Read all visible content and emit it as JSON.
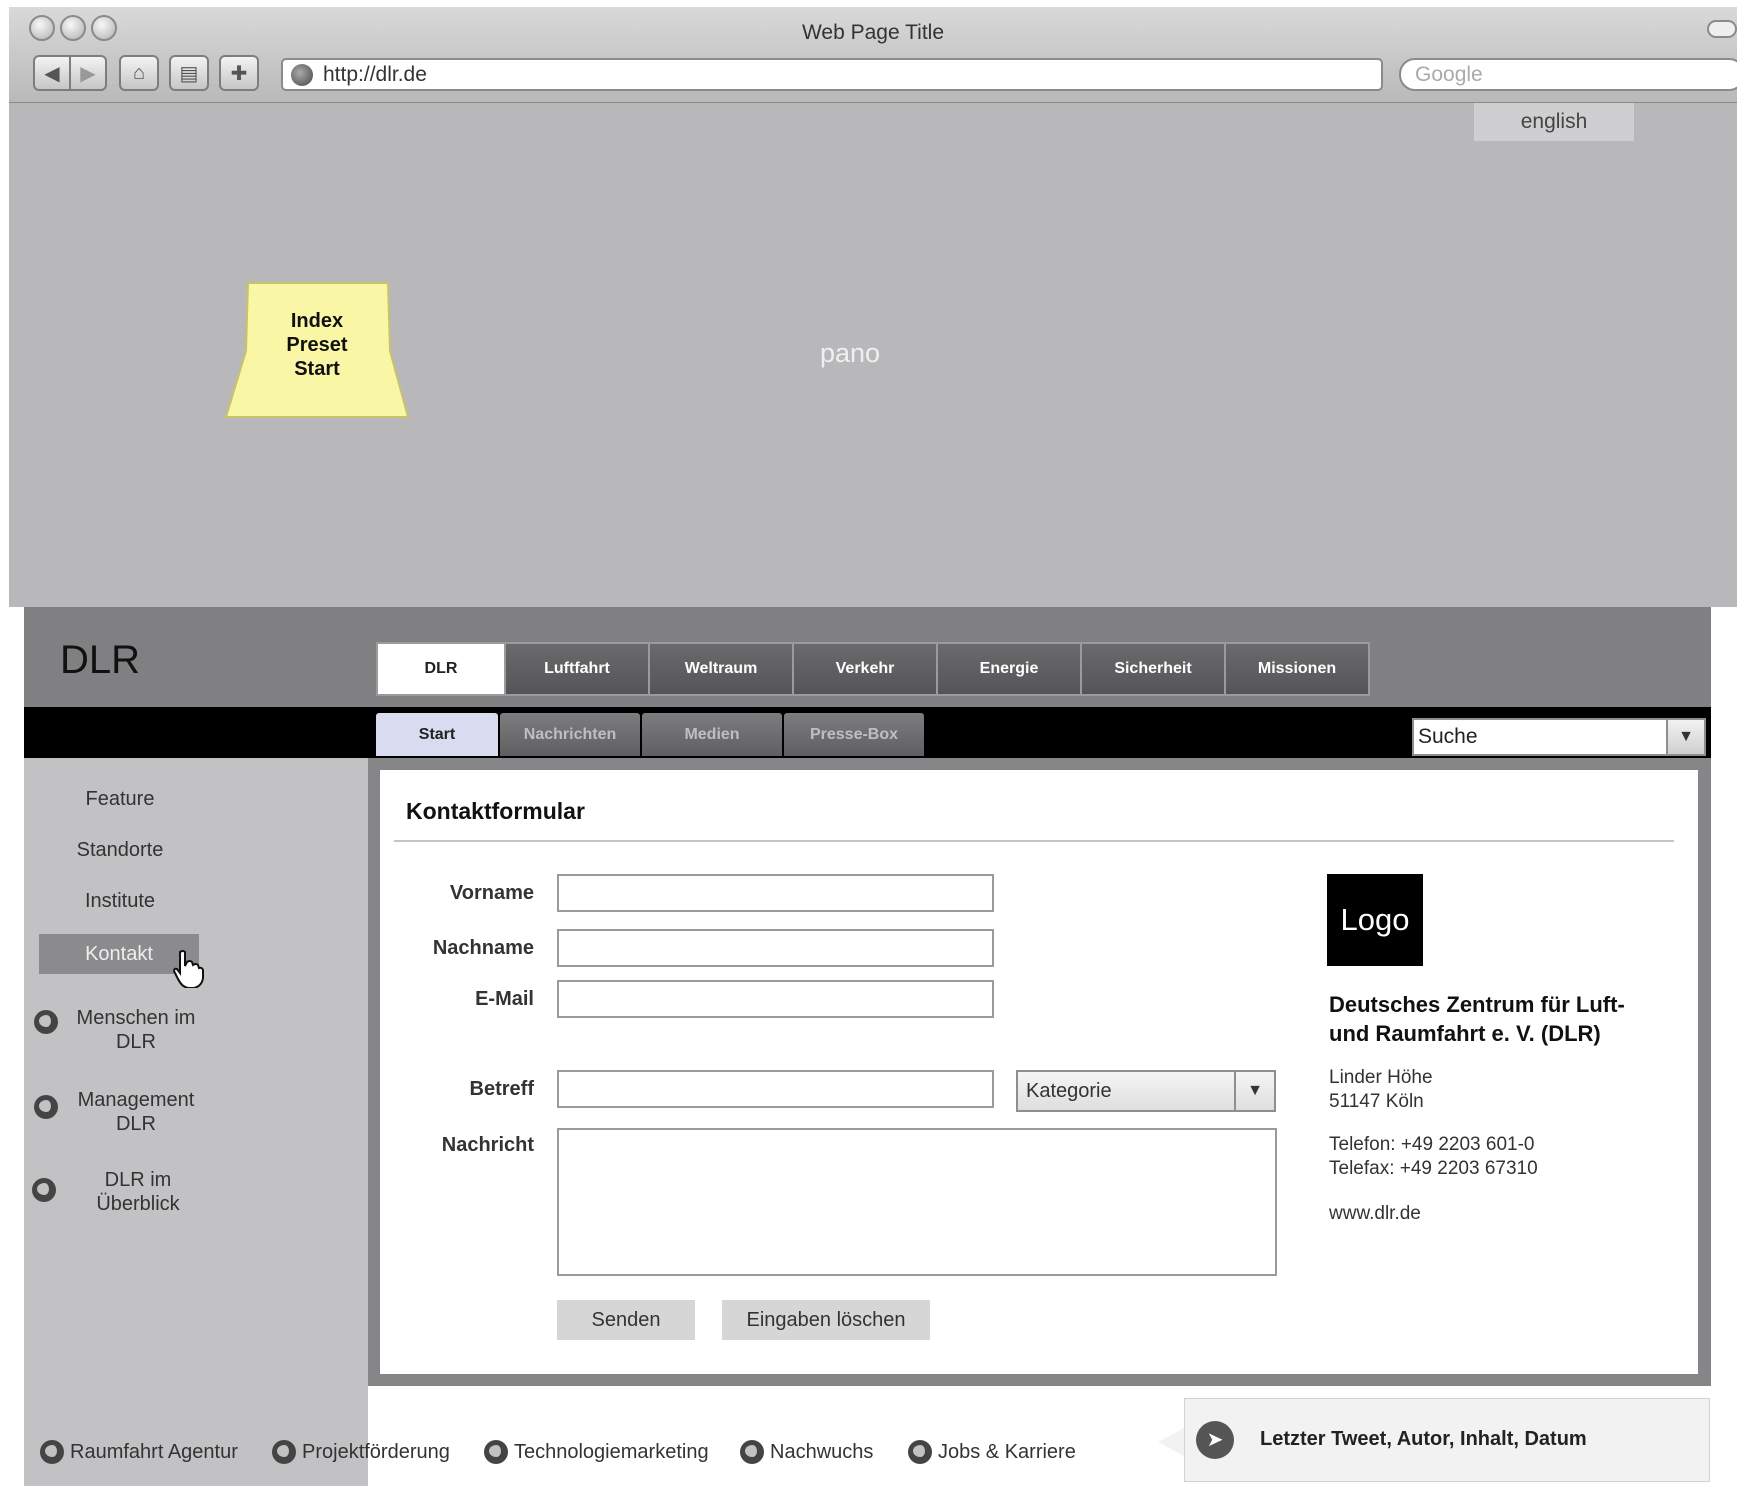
{
  "window": {
    "title": "Web Page Title",
    "url": "http://dlr.de",
    "search_placeholder": "Google"
  },
  "header": {
    "language_link": "english",
    "pano_label": "pano"
  },
  "sticky_note": {
    "line1": "Index",
    "line2": "Preset",
    "line3": "Start"
  },
  "site": {
    "logo_text": "DLR",
    "main_tabs": [
      "DLR",
      "Luftfahrt",
      "Weltraum",
      "Verkehr",
      "Energie",
      "Sicherheit",
      "Missionen"
    ],
    "sub_tabs": [
      "Start",
      "Nachrichten",
      "Medien",
      "Presse-Box"
    ],
    "search_value": "Suche"
  },
  "sidebar": {
    "items": [
      "Feature",
      "Standorte",
      "Institute",
      "Kontakt"
    ],
    "active": "Kontakt",
    "icon_items": [
      {
        "line1": "Menschen im",
        "line2": "DLR"
      },
      {
        "line1": "Management",
        "line2": "DLR"
      },
      {
        "line1": "DLR im",
        "line2": "Überblick"
      }
    ]
  },
  "form": {
    "title": "Kontaktformular",
    "labels": {
      "vorname": "Vorname",
      "nachname": "Nachname",
      "email": "E-Mail",
      "betreff": "Betreff",
      "nachricht": "Nachricht"
    },
    "kategorie": "Kategorie",
    "send_label": "Senden",
    "clear_label": "Eingaben löschen"
  },
  "contact_info": {
    "logo": "Logo",
    "org_line1": "Deutsches Zentrum für Luft-",
    "org_line2": "und Raumfahrt e. V. (DLR)",
    "address_line1": "Linder Höhe",
    "address_line2": "51147 Köln",
    "phone": "Telefon: +49 2203 601-0",
    "fax": "Telefax: +49 2203 67310",
    "web": "www.dlr.de"
  },
  "footer": {
    "links": [
      "Raumfahrt Agentur",
      "Projektförderung",
      "Technologiemarketing",
      "Nachwuchs",
      "Jobs & Karriere"
    ],
    "tweet": "Letzter Tweet, Autor, Inhalt, Datum"
  }
}
